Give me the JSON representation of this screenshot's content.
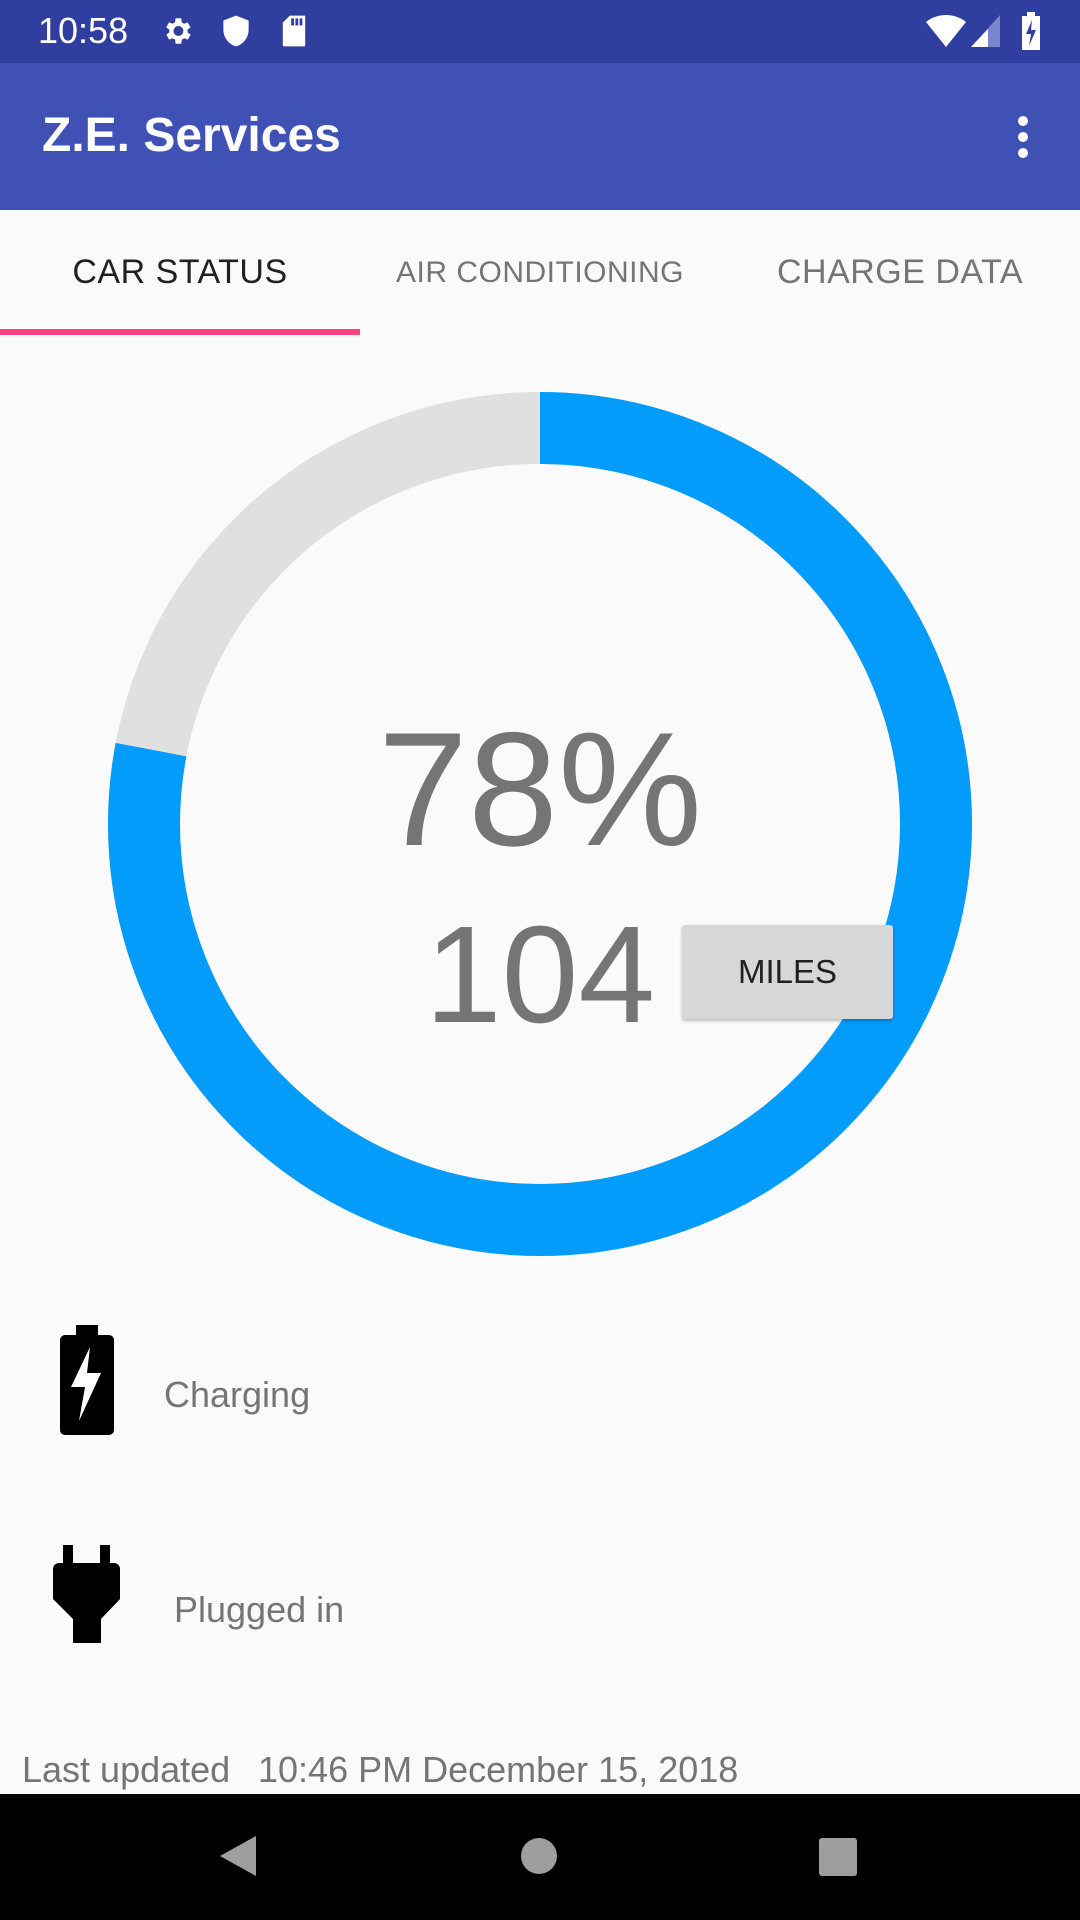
{
  "status_bar": {
    "time": "10:58",
    "icons": [
      "gear-icon",
      "shield-icon",
      "sd-card-icon",
      "wifi-icon",
      "signal-icon",
      "battery-charging-icon"
    ]
  },
  "app_bar": {
    "title": "Z.E. Services",
    "menu_icon": "more-vert-icon"
  },
  "tabs": [
    {
      "label": "CAR STATUS",
      "active": true
    },
    {
      "label": "AIR CONDITIONING",
      "active": false
    },
    {
      "label": "CHARGE DATA",
      "active": false
    }
  ],
  "gauge": {
    "percent": 78,
    "percent_label": "78%",
    "range_value": "104",
    "unit_button": "MILES",
    "colors": {
      "fill": "#039cfa",
      "track": "#e0e0e0"
    }
  },
  "status_items": [
    {
      "icon": "battery-charging-icon",
      "label": "Charging"
    },
    {
      "icon": "power-plug-icon",
      "label": "Plugged in"
    }
  ],
  "last_updated": {
    "label": "Last updated",
    "value": "10:46 PM December 15, 2018"
  },
  "colors": {
    "primary": "#3f51b5",
    "primary_dark": "#303f9f",
    "accent": "#ff4081"
  }
}
